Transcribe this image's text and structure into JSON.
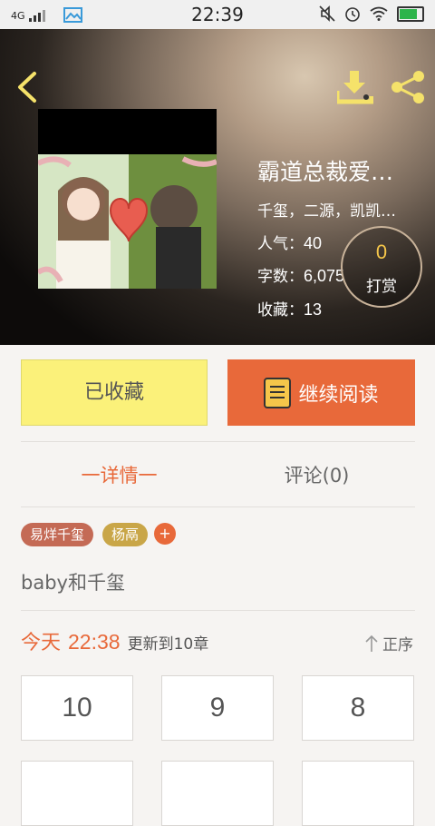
{
  "status_bar": {
    "network": "4G",
    "time": "22:39",
    "battery_level": 0.85
  },
  "book": {
    "title": "霸道总裁爱…",
    "authors": "千玺，二源，凯凯…",
    "popularity_label": "人气：",
    "popularity": "40",
    "word_count_label": "字数：",
    "word_count": "6,075",
    "favorites_label": "收藏：",
    "favorites": "13"
  },
  "tip": {
    "count": "0",
    "label": "打赏"
  },
  "actions": {
    "favorited_label": "已收藏",
    "continue_label": "继续阅读"
  },
  "tabs": [
    {
      "label": "一详情一"
    },
    {
      "label": "评论(0)"
    }
  ],
  "tags": [
    {
      "label": "易烊千玺",
      "color": "#c46a55"
    },
    {
      "label": "杨鬲",
      "color": "#c9a648"
    }
  ],
  "tag_add_label": "+",
  "description": "baby和千玺",
  "update": {
    "day": "今天",
    "time": "22:38",
    "text": "更新到10章"
  },
  "sort_label": "正序",
  "chapters": [
    "10",
    "9",
    "8"
  ],
  "colors": {
    "accent": "#e8693a",
    "favorite_bg": "#fbf17a",
    "icon_yellow": "#f5e26a"
  }
}
